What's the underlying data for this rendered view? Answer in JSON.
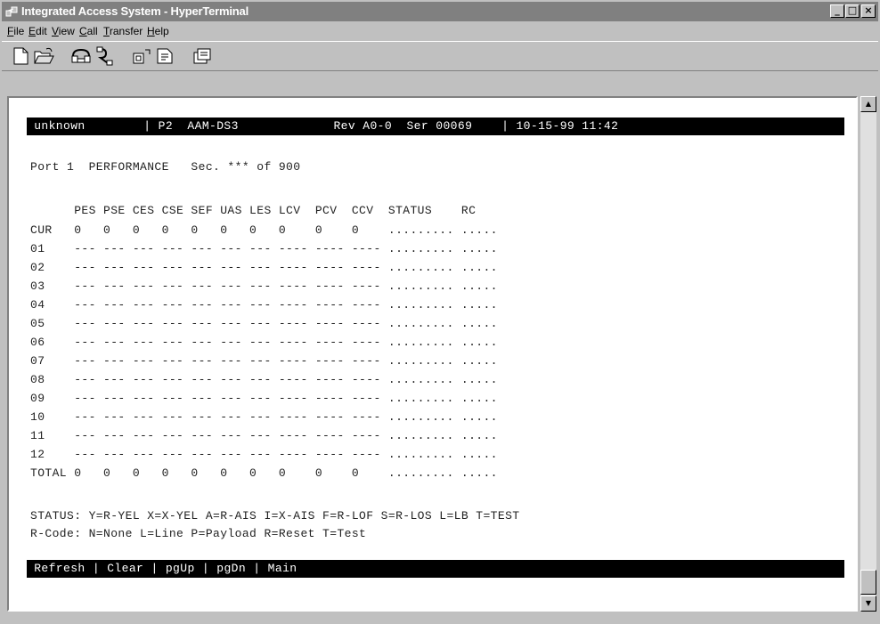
{
  "window": {
    "title": "Integrated Access System - HyperTerminal",
    "minimize_glyph": "_",
    "maximize_glyph": "□",
    "close_glyph": "×"
  },
  "menu": [
    {
      "underline": "F",
      "rest": "ile"
    },
    {
      "underline": "E",
      "rest": "dit"
    },
    {
      "underline": "V",
      "rest": "iew"
    },
    {
      "underline": "C",
      "rest": "all"
    },
    {
      "underline": "T",
      "rest": "ransfer"
    },
    {
      "underline": "H",
      "rest": "elp"
    }
  ],
  "toolbar": {
    "icons": [
      "new-icon",
      "open-icon",
      "connect-icon",
      "disconnect-icon",
      "send-icon",
      "receive-icon",
      "properties-icon"
    ]
  },
  "terminal": {
    "header": " unknown        | P2  AAM-DS3             Rev A0-0  Ser 00069    | 10-15-99 11:42",
    "title_line": "Port 1  PERFORMANCE   Sec. *** of 900",
    "column_header": "      PES PSE CES CSE SEF UAS LES LCV  PCV  CCV  STATUS    RC",
    "rows": [
      "CUR   0   0   0   0   0   0   0   0    0    0    ......... .....",
      "01    --- --- --- --- --- --- --- ---- ---- ---- ......... .....",
      "02    --- --- --- --- --- --- --- ---- ---- ---- ......... .....",
      "03    --- --- --- --- --- --- --- ---- ---- ---- ......... .....",
      "04    --- --- --- --- --- --- --- ---- ---- ---- ......... .....",
      "05    --- --- --- --- --- --- --- ---- ---- ---- ......... .....",
      "06    --- --- --- --- --- --- --- ---- ---- ---- ......... .....",
      "07    --- --- --- --- --- --- --- ---- ---- ---- ......... .....",
      "08    --- --- --- --- --- --- --- ---- ---- ---- ......... .....",
      "09    --- --- --- --- --- --- --- ---- ---- ---- ......... .....",
      "10    --- --- --- --- --- --- --- ---- ---- ---- ......... .....",
      "11    --- --- --- --- --- --- --- ---- ---- ---- ......... .....",
      "12    --- --- --- --- --- --- --- ---- ---- ---- ......... .....",
      "TOTAL 0   0   0   0   0   0   0   0    0    0    ......... ....."
    ],
    "status_legend": "STATUS: Y=R-YEL X=X-YEL A=R-AIS I=X-AIS F=R-LOF S=R-LOS L=LB T=TEST",
    "rcode_legend": "R-Code: N=None L=Line P=Payload R=Reset T=Test",
    "commands": [
      " Refresh ",
      " Clear ",
      " pgUp ",
      " pgDn ",
      " Main"
    ]
  },
  "scrollbar": {
    "up_glyph": "▲",
    "down_glyph": "▼"
  }
}
